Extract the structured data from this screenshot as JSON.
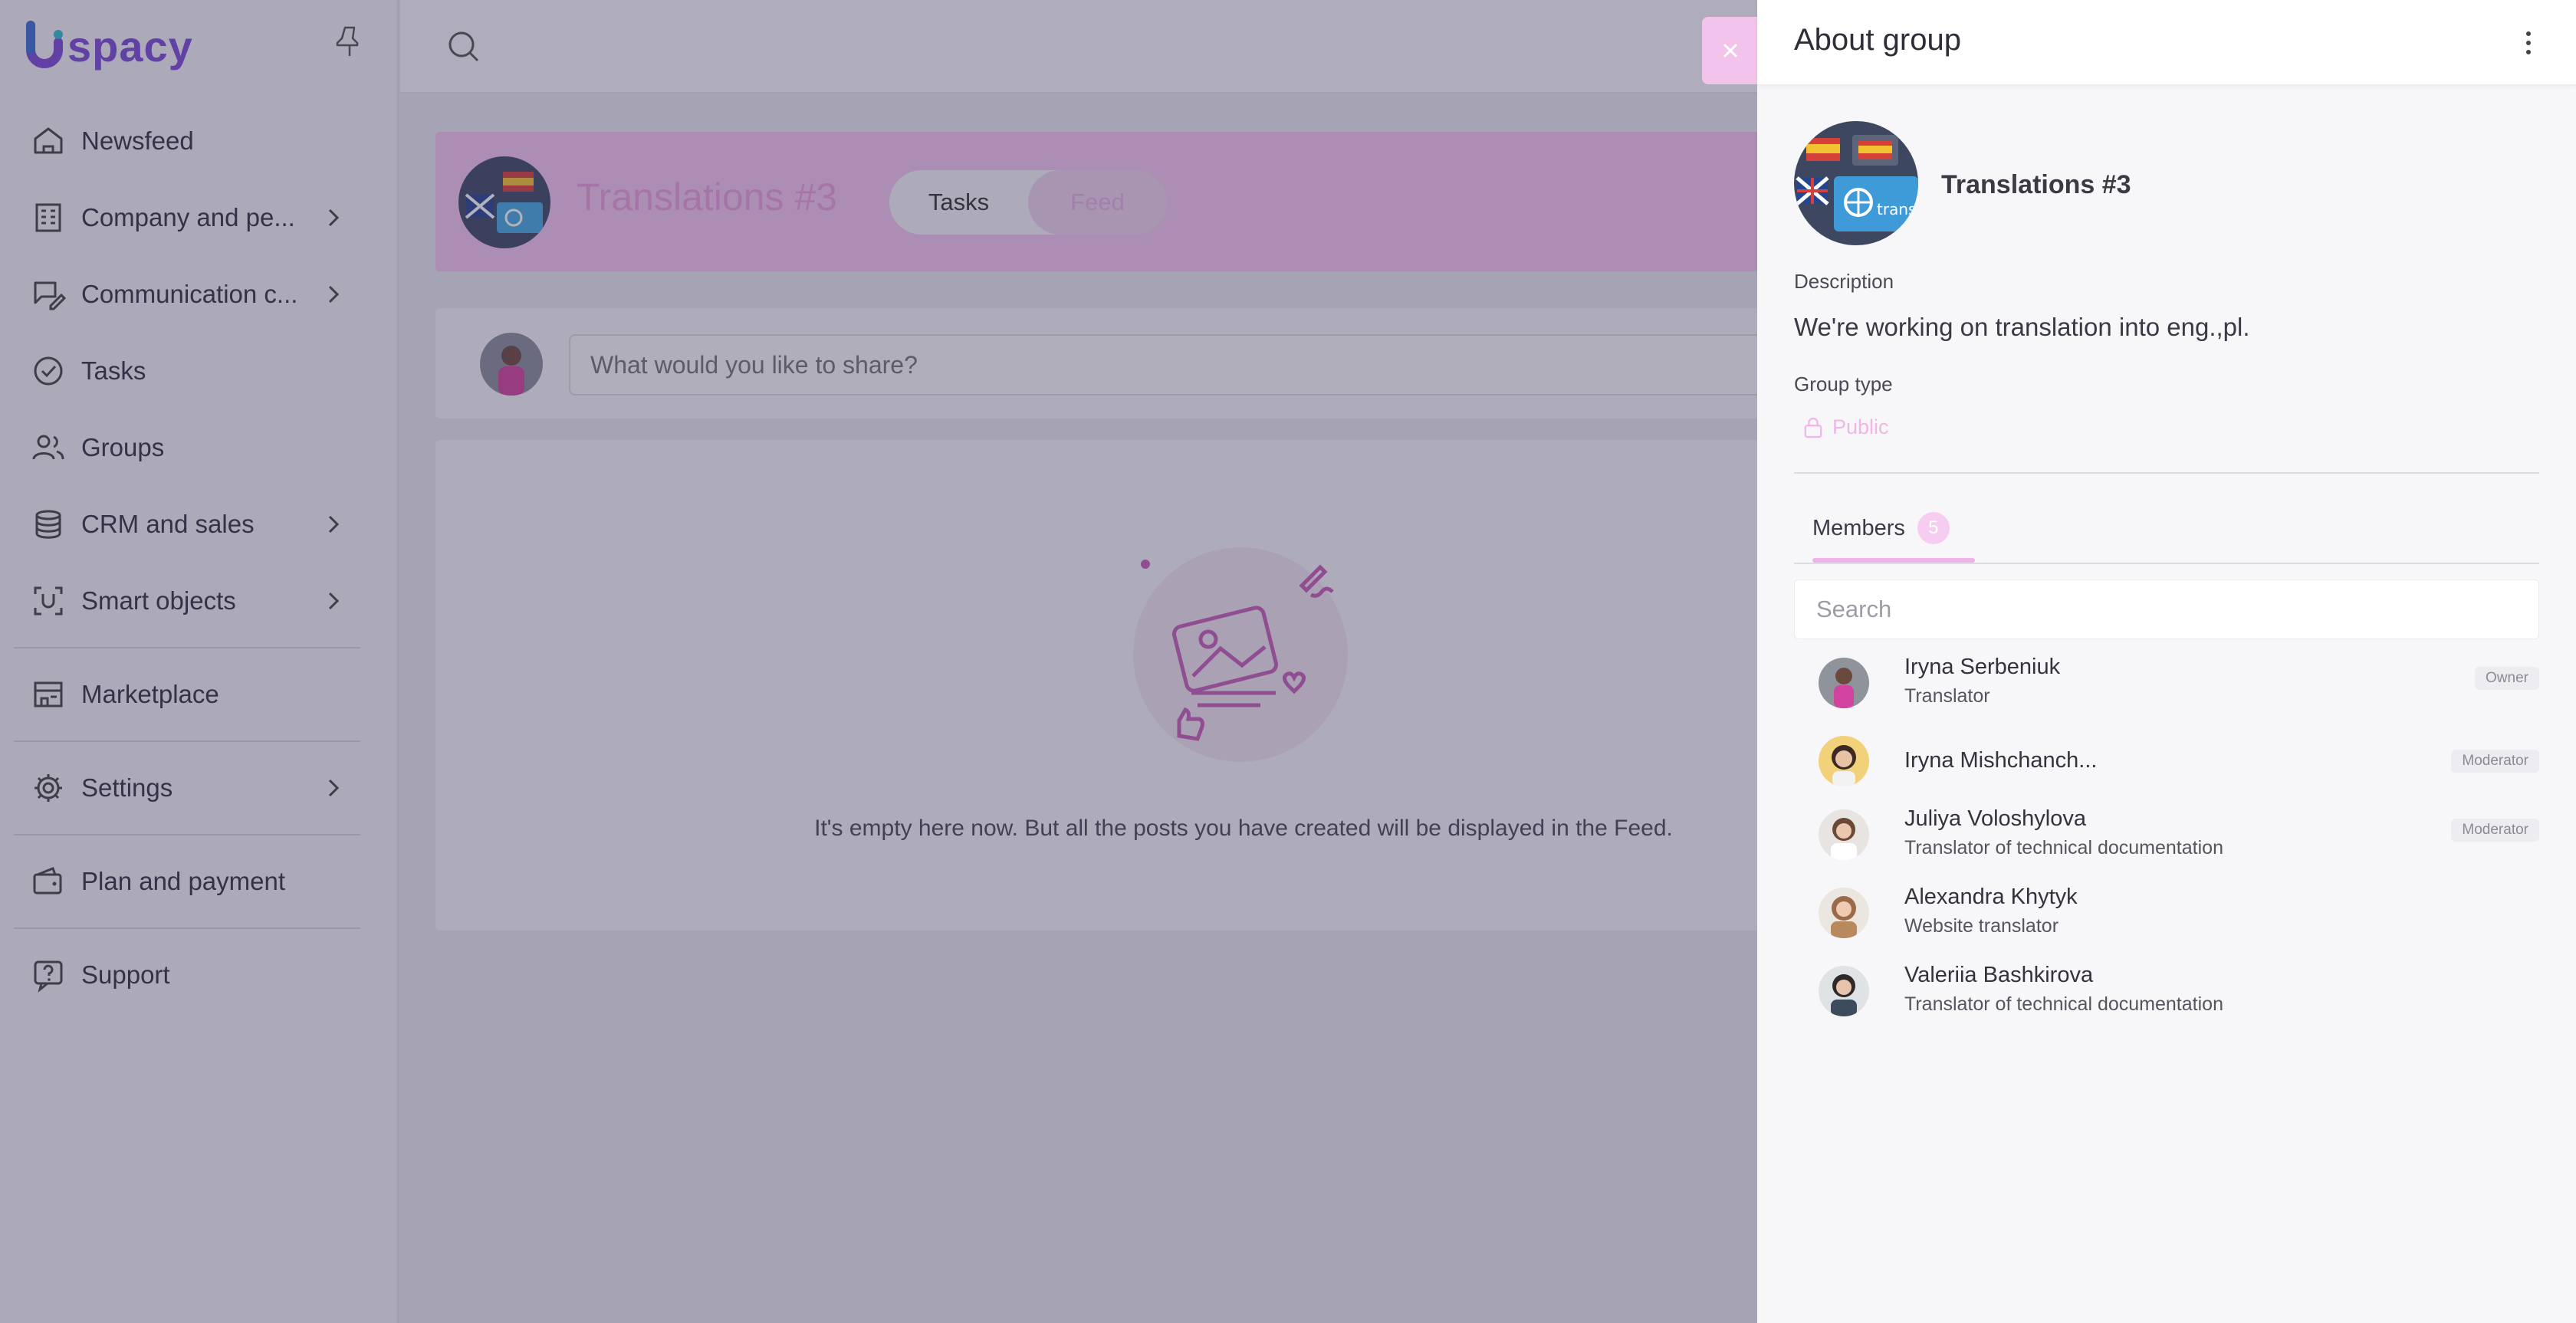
{
  "app": {
    "logo_text": "spacy",
    "search_icon": "search-icon",
    "pin_icon": "pin-icon"
  },
  "sidebar": {
    "items": [
      {
        "label": "Newsfeed",
        "icon": "home-icon",
        "has_submenu": false
      },
      {
        "label": "Company and pe...",
        "icon": "building-icon",
        "has_submenu": true
      },
      {
        "label": "Communication c...",
        "icon": "chat-edit-icon",
        "has_submenu": true
      },
      {
        "label": "Tasks",
        "icon": "check-circle-icon",
        "has_submenu": false
      },
      {
        "label": "Groups",
        "icon": "users-icon",
        "has_submenu": false
      },
      {
        "label": "CRM and sales",
        "icon": "coins-icon",
        "has_submenu": true
      },
      {
        "label": "Smart objects",
        "icon": "smart-object-icon",
        "has_submenu": true
      },
      {
        "label": "Marketplace",
        "icon": "store-icon",
        "has_submenu": false
      },
      {
        "label": "Settings",
        "icon": "gear-icon",
        "has_submenu": true
      },
      {
        "label": "Plan and payment",
        "icon": "wallet-icon",
        "has_submenu": false
      },
      {
        "label": "Support",
        "icon": "help-icon",
        "has_submenu": false
      }
    ]
  },
  "group_page": {
    "title": "Translations #3",
    "tabs": [
      "Tasks",
      "Feed"
    ],
    "active_tab": "Feed",
    "composer_placeholder": "What would you like to share?",
    "empty_text": "It's empty here now. But all the posts you have created will be displayed in the Feed."
  },
  "panel": {
    "title": "About group",
    "group_name": "Translations #3",
    "description_label": "Description",
    "description": "We're working on translation into eng.,pl.",
    "group_type_label": "Group type",
    "group_type": "Public",
    "members_tab": "Members",
    "members_count": "5",
    "search_placeholder": "Search",
    "members": [
      {
        "name": "Iryna Serbeniuk",
        "role": "Translator",
        "badge": "Owner"
      },
      {
        "name": "Iryna Mishchanch...",
        "role": "",
        "badge": "Moderator"
      },
      {
        "name": "Juliya Voloshylova",
        "role": "Translator of technical documentation",
        "badge": "Moderator"
      },
      {
        "name": "Alexandra Khytyk",
        "role": "Website translator",
        "badge": ""
      },
      {
        "name": "Valeriia Bashkirova",
        "role": "Translator of technical documentation",
        "badge": ""
      }
    ]
  },
  "colors": {
    "accent_pink": "#f0b6e8",
    "brand_purple": "#7a4bd6",
    "overlay": "#3a3254"
  }
}
